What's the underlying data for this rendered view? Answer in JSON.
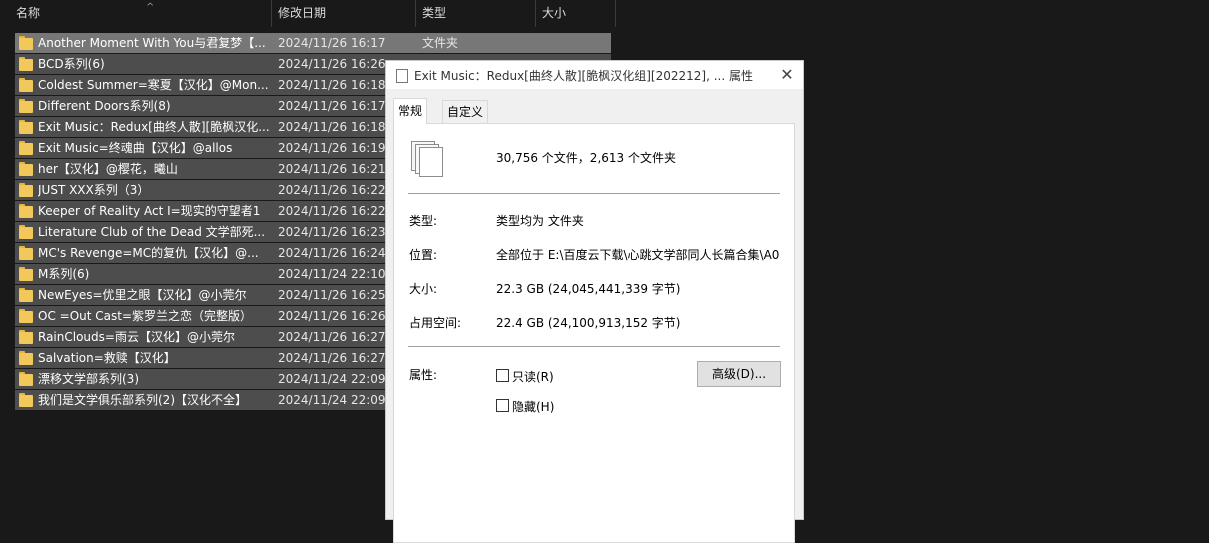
{
  "columns": {
    "name": "名称",
    "date": "修改日期",
    "type": "类型",
    "size": "大小"
  },
  "files": [
    {
      "name": "Another Moment With You与君复梦【...",
      "date": "2024/11/26 16:17",
      "type": "文件夹"
    },
    {
      "name": "BCD系列(6)",
      "date": "2024/11/26 16:26",
      "type": ""
    },
    {
      "name": "Coldest Summer=寒夏【汉化】@Mon...",
      "date": "2024/11/26 16:18",
      "type": ""
    },
    {
      "name": "Different Doors系列(8)",
      "date": "2024/11/26 16:17",
      "type": ""
    },
    {
      "name": "Exit Music：Redux[曲终人散][脆枫汉化...",
      "date": "2024/11/26 16:18",
      "type": ""
    },
    {
      "name": "Exit Music=终魂曲【汉化】@allos",
      "date": "2024/11/26 16:19",
      "type": ""
    },
    {
      "name": "her【汉化】@樱花，曦山",
      "date": "2024/11/26 16:21",
      "type": ""
    },
    {
      "name": "JUST XXX系列（3）",
      "date": "2024/11/26 16:22",
      "type": ""
    },
    {
      "name": "Keeper of Reality Act I=现实的守望者1",
      "date": "2024/11/26 16:22",
      "type": ""
    },
    {
      "name": "Literature Club of the Dead 文学部死...",
      "date": "2024/11/26 16:23",
      "type": ""
    },
    {
      "name": "MC's Revenge=MC的复仇【汉化】@...",
      "date": "2024/11/26 16:24",
      "type": ""
    },
    {
      "name": "M系列(6)",
      "date": "2024/11/24 22:10",
      "type": ""
    },
    {
      "name": "NewEyes=优里之眼【汉化】@小莞尔",
      "date": "2024/11/26 16:25",
      "type": ""
    },
    {
      "name": "OC =Out Cast=紫罗兰之恋（完整版）",
      "date": "2024/11/26 16:26",
      "type": ""
    },
    {
      "name": "RainClouds=雨云【汉化】@小莞尔",
      "date": "2024/11/26 16:27",
      "type": ""
    },
    {
      "name": "Salvation=救赎【汉化】",
      "date": "2024/11/26 16:27",
      "type": ""
    },
    {
      "name": "漂移文学部系列(3)",
      "date": "2024/11/24 22:09",
      "type": ""
    },
    {
      "name": "我们是文学俱乐部系列(2)【汉化不全】",
      "date": "2024/11/24 22:09",
      "type": ""
    }
  ],
  "dialog": {
    "title": "Exit Music：Redux[曲终人散][脆枫汉化组][202212], ... 属性",
    "close": "✕",
    "tabs": [
      "常规",
      "自定义"
    ],
    "summary": "30,756 个文件，2,613 个文件夹",
    "type_label": "类型:",
    "type_value": "类型均为 文件夹",
    "location_label": "位置:",
    "location_value": "全部位于 E:\\百度云下载\\心跳文学部同人长篇合集\\A0",
    "size_label": "大小:",
    "size_value": "22.3 GB (24,045,441,339 字节)",
    "disk_label": "占用空间:",
    "disk_value": "22.4 GB (24,100,913,152 字节)",
    "attr_label": "属性:",
    "readonly_label": "只读(R)",
    "hidden_label": "隐藏(H)",
    "advanced_label": "高级(D)..."
  }
}
